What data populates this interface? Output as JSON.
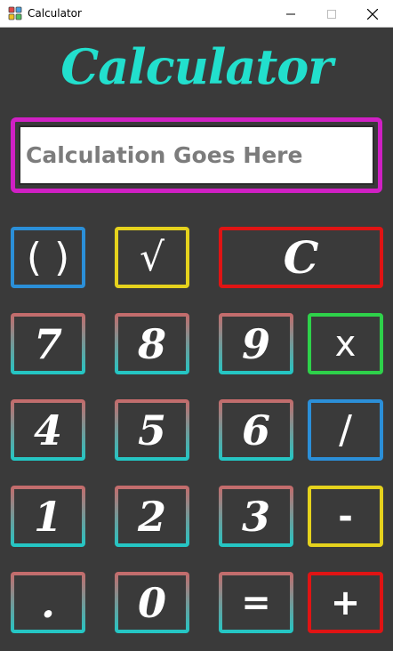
{
  "window": {
    "title": "Calculator"
  },
  "header": {
    "title": "Calculator"
  },
  "display": {
    "placeholder": "Calculation Goes Here"
  },
  "colors": {
    "background": "#3a3a3a",
    "title": "#22dfcd",
    "display_border": "#d020c4",
    "blue": "#2b8fd8",
    "yellow": "#e5d21d",
    "red": "#e01414",
    "green": "#2ed14a",
    "gradient_top": "#c76a6a",
    "gradient_bottom": "#20c8c6"
  },
  "keys": {
    "paren": "( )",
    "sqrt": "√",
    "clear": "C",
    "seven": "7",
    "eight": "8",
    "nine": "9",
    "multiply": "x",
    "four": "4",
    "five": "5",
    "six": "6",
    "divide": "/",
    "one": "1",
    "two": "2",
    "three": "3",
    "subtract": "-",
    "decimal": ".",
    "zero": "0",
    "equals": "=",
    "add": "+"
  }
}
